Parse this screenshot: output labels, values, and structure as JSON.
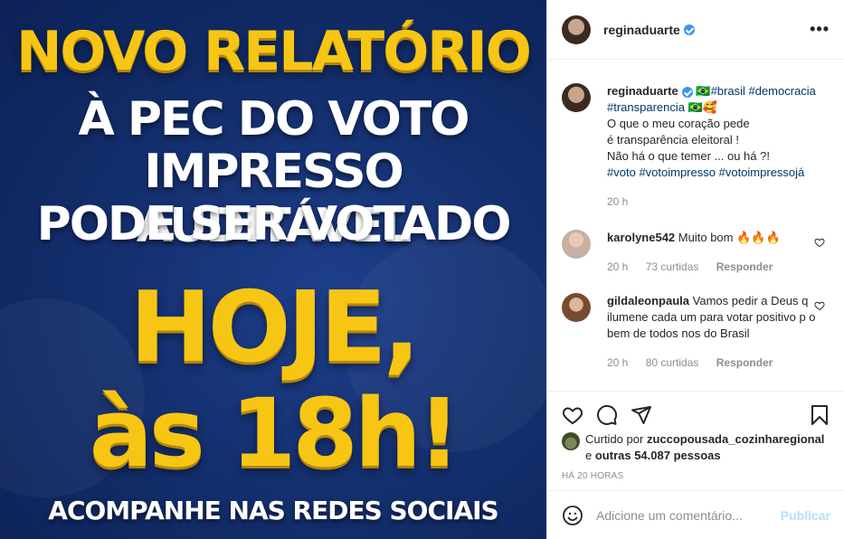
{
  "image": {
    "line1": "NOVO RELATÓRIO",
    "line2": "À PEC DO VOTO",
    "line3": "IMPRESSO AUDITÁVEL",
    "line4": "PODE SER VOTADO",
    "line5": "HOJE,",
    "line6": "às 18h!",
    "line7": "ACOMPANHE NAS REDES SOCIAIS"
  },
  "header": {
    "username": "reginaduarte",
    "more_icon": "more-options-icon"
  },
  "caption": {
    "username": "reginaduarte",
    "flag": "🇧🇷",
    "tag_brasil": "#brasil",
    "tag_democracia": "#democracia",
    "tag_transparencia": "#transparencia",
    "emoji": "🇧🇷🥰",
    "line1": "O que o meu coração pede",
    "line2": "é transparência eleitoral !",
    "line3": "Não há o que temer ... ou há ?!",
    "tag_voto": "#voto",
    "tag_votoimpresso": "#votoimpresso",
    "tag_votoimpressoja": "#votoimpressojá",
    "time": "20 h"
  },
  "comments": [
    {
      "username": "karolyne542",
      "text": "Muito bom 🔥🔥🔥",
      "time": "20 h",
      "likes": "73 curtidas",
      "reply": "Responder"
    },
    {
      "username": "gildaleonpaula",
      "text": "Vamos pedir a Deus q ilumene cada um para votar positivo p o bem de todos nos do Brasil",
      "time": "20 h",
      "likes": "80 curtidas",
      "reply": "Responder"
    }
  ],
  "likes": {
    "prefix": "Curtido por",
    "user": "zuccopousada_cozinharegional",
    "and": "e",
    "others": "outras 54.087 pessoas"
  },
  "timeago": "HÁ 20 HORAS",
  "add_comment": {
    "placeholder": "Adicione um comentário...",
    "publish": "Publicar"
  },
  "colors": {
    "brand_yellow": "#f7c614",
    "bg_blue": "#14306f",
    "link": "#00376b",
    "publish_disabled": "#b2dffc"
  }
}
